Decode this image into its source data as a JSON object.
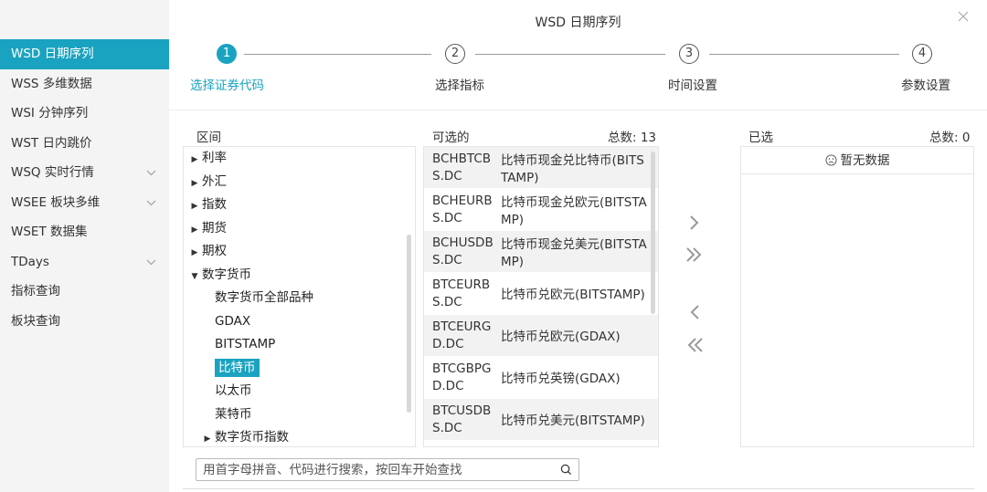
{
  "sidebar": {
    "items": [
      {
        "label": "WSD 日期序列",
        "active": true,
        "expandable": false
      },
      {
        "label": "WSS 多维数据",
        "active": false,
        "expandable": false
      },
      {
        "label": "WSI 分钟序列",
        "active": false,
        "expandable": false
      },
      {
        "label": "WST 日内跳价",
        "active": false,
        "expandable": false
      },
      {
        "label": "WSQ 实时行情",
        "active": false,
        "expandable": true
      },
      {
        "label": "WSEE 板块多维",
        "active": false,
        "expandable": true
      },
      {
        "label": "WSET 数据集",
        "active": false,
        "expandable": false
      },
      {
        "label": "TDays",
        "active": false,
        "expandable": true
      },
      {
        "label": "指标查询",
        "active": false,
        "expandable": false
      },
      {
        "label": "板块查询",
        "active": false,
        "expandable": false
      }
    ]
  },
  "dialog": {
    "title": "WSD 日期序列",
    "close_icon": "close-icon"
  },
  "stepper": {
    "steps": [
      {
        "number": "1",
        "label": "选择证券代码",
        "active": true
      },
      {
        "number": "2",
        "label": "选择指标",
        "active": false
      },
      {
        "number": "3",
        "label": "时间设置",
        "active": false
      },
      {
        "number": "4",
        "label": "参数设置",
        "active": false
      }
    ]
  },
  "tree": {
    "header": "区间",
    "nodes": [
      {
        "label": "利率",
        "level": 0,
        "arrow": "right"
      },
      {
        "label": "外汇",
        "level": 0,
        "arrow": "right"
      },
      {
        "label": "指数",
        "level": 0,
        "arrow": "right"
      },
      {
        "label": "期货",
        "level": 0,
        "arrow": "right"
      },
      {
        "label": "期权",
        "level": 0,
        "arrow": "right"
      },
      {
        "label": "数字货币",
        "level": 0,
        "arrow": "down"
      },
      {
        "label": "数字货币全部品种",
        "level": 1,
        "arrow": "none"
      },
      {
        "label": "GDAX",
        "level": 1,
        "arrow": "none"
      },
      {
        "label": "BITSTAMP",
        "level": 1,
        "arrow": "none"
      },
      {
        "label": "比特币",
        "level": 1,
        "arrow": "none",
        "selected": true
      },
      {
        "label": "以太币",
        "level": 1,
        "arrow": "none"
      },
      {
        "label": "莱特币",
        "level": 1,
        "arrow": "none"
      },
      {
        "label": "数字货币指数",
        "level": 1,
        "arrow": "right"
      }
    ]
  },
  "available": {
    "header": "可选的",
    "total": "总数: 13",
    "rows": [
      {
        "code": "BCHBTCBS.DC",
        "name": "比特币现金兑比特币(BITSTAMP)"
      },
      {
        "code": "BCHEURBS.DC",
        "name": "比特币现金兑欧元(BITSTAMP)"
      },
      {
        "code": "BCHUSDBS.DC",
        "name": "比特币现金兑美元(BITSTAMP)"
      },
      {
        "code": "BTCEURBS.DC",
        "name": "比特币兑欧元(BITSTAMP)"
      },
      {
        "code": "BTCEURGD.DC",
        "name": "比特币兑欧元(GDAX)"
      },
      {
        "code": "BTCGBPGD.DC",
        "name": "比特币兑英镑(GDAX)"
      },
      {
        "code": "BTCUSDBS.DC",
        "name": "比特币兑美元(BITSTAMP)"
      }
    ]
  },
  "selected": {
    "header": "已选",
    "total": "总数: 0",
    "empty_text": "暂无数据"
  },
  "search": {
    "placeholder": "用首字母拼音、代码进行搜索，按回车开始查找",
    "value": ""
  },
  "colors": {
    "accent": "#1aa3c0"
  }
}
